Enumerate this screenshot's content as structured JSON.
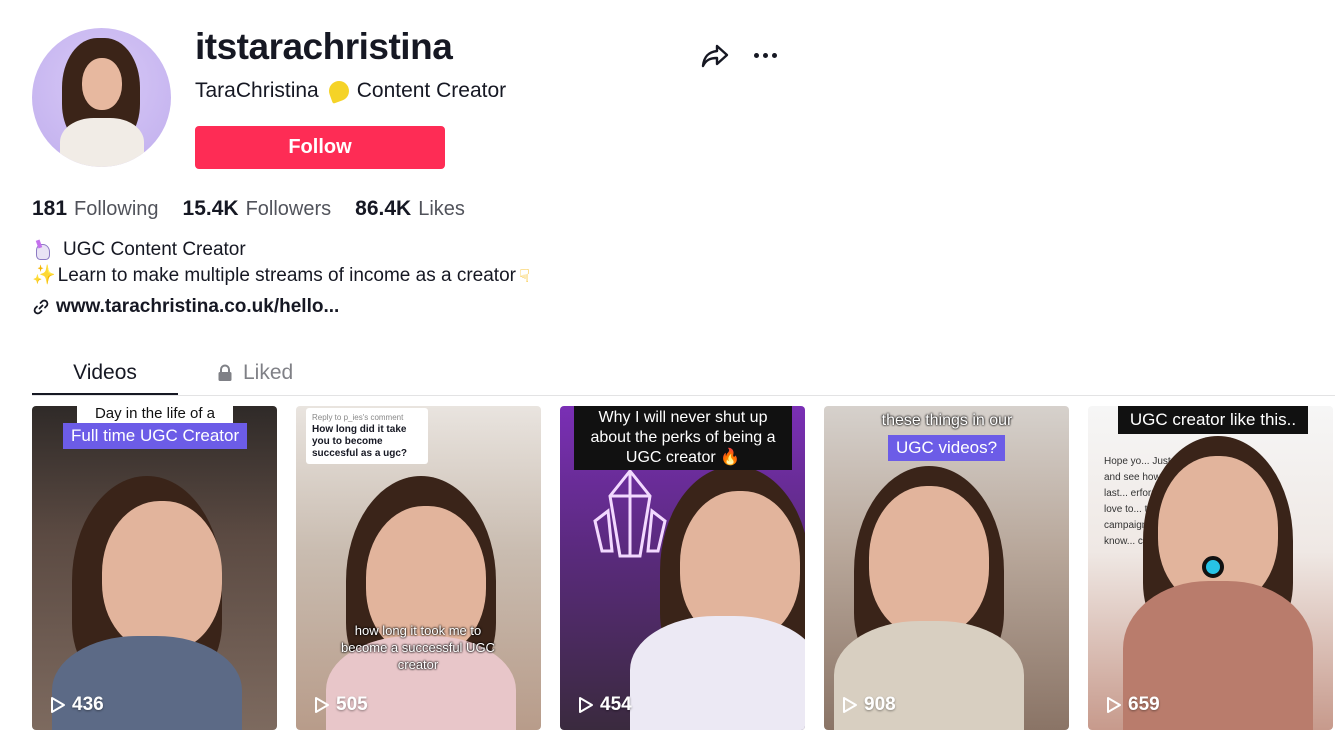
{
  "profile": {
    "username": "itstarachristina",
    "nickname": "TaraChristina",
    "nickname_suffix": "Content Creator",
    "follow_label": "Follow"
  },
  "stats": [
    {
      "value": "181",
      "label": "Following"
    },
    {
      "value": "15.4K",
      "label": "Followers"
    },
    {
      "value": "86.4K",
      "label": "Likes"
    }
  ],
  "bio": {
    "line1": "UGC Content Creator",
    "line2": "Learn to make multiple streams of income as a creator"
  },
  "link": "www.tarachristina.co.uk/hello...",
  "tabs": [
    {
      "label": "Videos",
      "active": true
    },
    {
      "label": "Liked",
      "active": false,
      "icon": "lock-icon"
    }
  ],
  "videos": [
    {
      "views": "436",
      "caption_top": "Day in the life of a",
      "caption_tag": "Full time UGC Creator"
    },
    {
      "views": "505",
      "reply_header": "Reply to p_ies's comment",
      "reply_text": "How long did it take you to become succesful as a ugc?",
      "caption_bottom": "how long it took me to become a successful UGC creator"
    },
    {
      "views": "454",
      "caption_top": "Why I will never shut up about the perks of being a UGC creator 🔥"
    },
    {
      "views": "908",
      "caption_top": "these things in our",
      "caption_tag": "UGC videos?"
    },
    {
      "views": "659",
      "caption_top": "UGC creator like this..",
      "body_text": "Hope yo... Just wa... and see how the last... erformed? I'd love to... the campaign... Let me know... content f..."
    }
  ],
  "colors": {
    "accent": "#fe2c55",
    "text": "#161823"
  }
}
